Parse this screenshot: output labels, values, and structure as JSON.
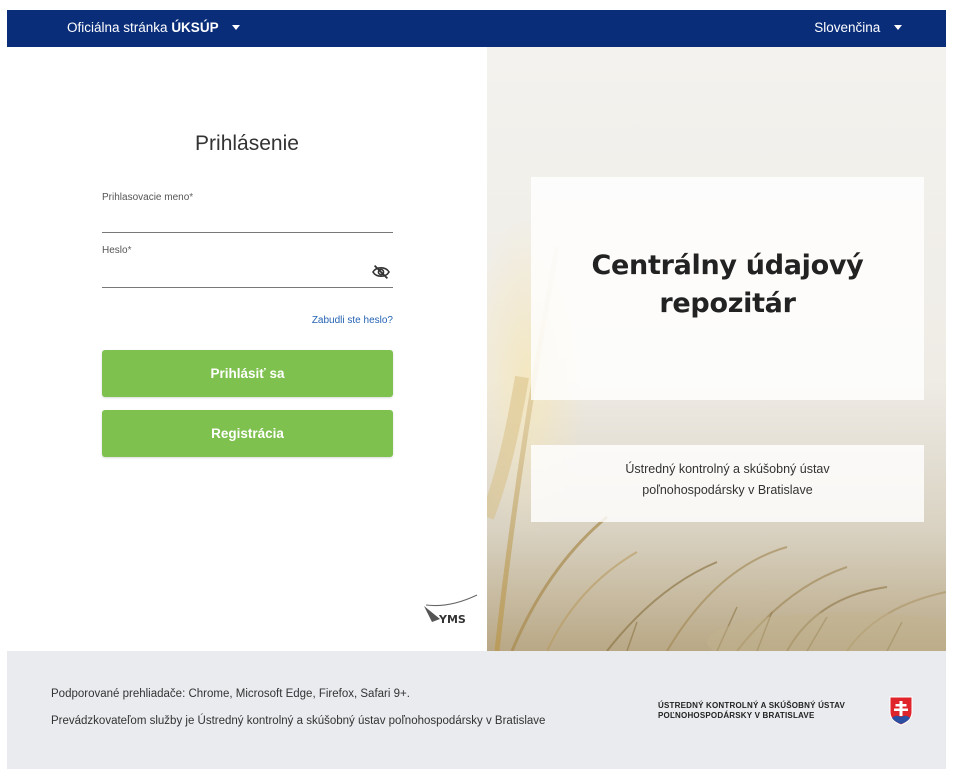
{
  "topbar": {
    "official_prefix": "Oficiálna stránka",
    "official_brand": "ÚKSÚP",
    "language": "Slovenčina"
  },
  "login": {
    "title": "Prihlásenie",
    "username_label": "Prihlasovacie meno",
    "username_value": "",
    "password_label": "Heslo",
    "password_value": "",
    "required_mark": "*",
    "forgot_link": "Zabudli ste heslo?",
    "login_button": "Prihlásiť sa",
    "register_button": "Registrácia",
    "vendor_logo": "YMS"
  },
  "hero": {
    "title": "Centrálny údajový repozitár",
    "subtitle_line1": "Ústredný kontrolný a skúšobný ústav",
    "subtitle_line2": "poľnohospodársky v Bratislave"
  },
  "footer": {
    "browsers": "Podporované prehliadače: Chrome, Microsoft Edge, Firefox, Safari 9+.",
    "operator": "Prevádzkovateľom služby je Ústredný kontrolný a skúšobný ústav poľnohospodársky v Bratislave",
    "org_line1": "ÚSTREDNÝ KONTROLNÝ A SKÚŠOBNÝ ÚSTAV",
    "org_line2": "POĽNOHOSPODÁRSKY V BRATISLAVE"
  },
  "colors": {
    "topbar": "#0a2d7a",
    "button": "#7ec14f",
    "link": "#2563b3",
    "footer": "#e9ebee"
  },
  "icons": {
    "password_toggle": "eye-off-icon",
    "dropdown": "caret-down-icon",
    "crest": "slovak-crest-icon"
  }
}
